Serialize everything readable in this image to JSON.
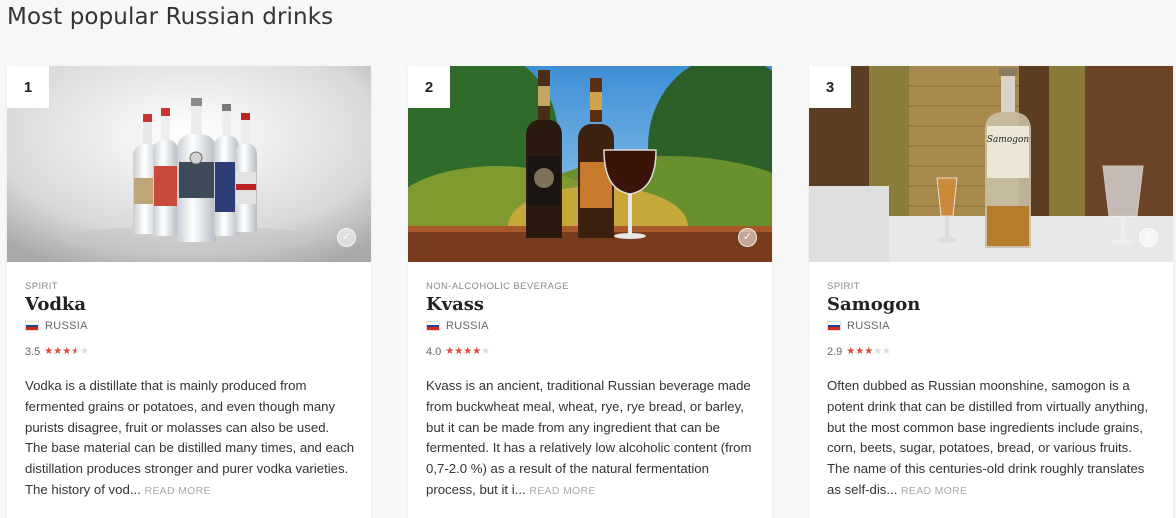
{
  "page": {
    "title": "Most popular Russian drinks"
  },
  "cards": [
    {
      "rank": "1",
      "category": "SPIRIT",
      "name": "Vodka",
      "country": "RUSSIA",
      "rating": "3.5",
      "rating_value": 3.5,
      "description": "Vodka is a distillate that is mainly produced from fermented grains or potatoes, and even though many purists disagree, fruit or molasses can also be used. The base material can be distilled many times, and each distillation produces stronger and purer vodka varieties. The history of vod...",
      "read_more": "READ MORE",
      "image_icon": "check-icon"
    },
    {
      "rank": "2",
      "category": "NON-ALCOHOLIC BEVERAGE",
      "name": "Kvass",
      "country": "RUSSIA",
      "rating": "4.0",
      "rating_value": 4.0,
      "description": "Kvass is an ancient, traditional Russian beverage made from buckwheat meal, wheat, rye, rye bread, or barley, but it can be made from any ingredient that can be fermented. It has a relatively low alcoholic content (from 0,7-2.0 %) as a result of the natural fermentation process, but it i...",
      "read_more": "READ MORE",
      "image_icon": "check-icon"
    },
    {
      "rank": "3",
      "category": "SPIRIT",
      "name": "Samogon",
      "country": "RUSSIA",
      "rating": "2.9",
      "rating_value": 2.9,
      "description": "Often dubbed as Russian moonshine, samogon is a potent drink that can be distilled from virtually anything, but the most common base ingredients include grains, corn, beets, sugar, potatoes, bread, or various fruits. The name of this centuries-old drink roughly translates as self-dis...",
      "read_more": "READ MORE",
      "image_icon": "check-icon",
      "bottle_label": "Samogon"
    }
  ],
  "colors": {
    "star_filled": "#e0493b",
    "star_empty": "#dcdcdc",
    "flag_white": "#ffffff",
    "flag_blue": "#1c3f94",
    "flag_red": "#d52b1e"
  }
}
